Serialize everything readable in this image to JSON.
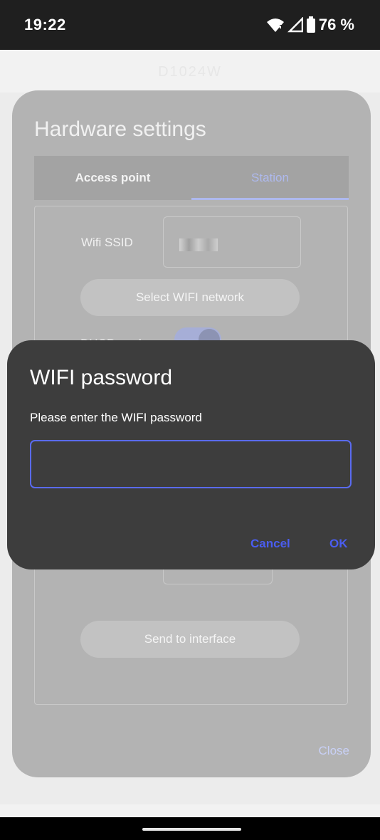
{
  "status_bar": {
    "time": "19:22",
    "battery": "76 %",
    "icons": [
      "wifi-icon",
      "signal-icon",
      "battery-icon"
    ]
  },
  "app": {
    "title": "D1024W"
  },
  "hardware_dialog": {
    "title": "Hardware settings",
    "tabs": [
      {
        "label": "Access point",
        "selected": false
      },
      {
        "label": "Station",
        "selected": true
      }
    ],
    "ssid_label": "Wifi SSID",
    "select_wifi_button": "Select WIFI network",
    "dhcp_label": "DHCP mode",
    "dhcp_enabled": true,
    "send_button": "Send to interface",
    "close_button": "Close"
  },
  "password_dialog": {
    "title": "WIFI password",
    "message": "Please enter the WIFI password",
    "input_value": "",
    "cancel_label": "Cancel",
    "ok_label": "OK"
  },
  "colors": {
    "accent": "#4a5df0",
    "dialog_bg": "#3d3d3d",
    "status_bar_bg": "#1f1f1f"
  }
}
